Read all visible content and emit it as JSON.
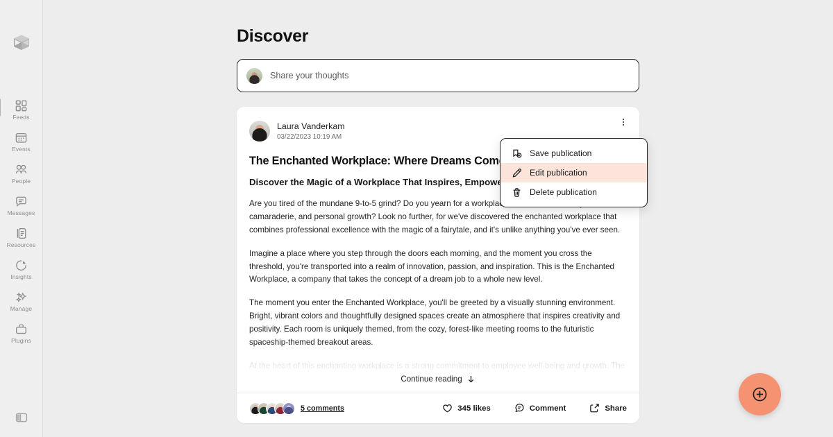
{
  "theme": {
    "app_bg": "#ededed",
    "sidebar_bg": "#f0efef",
    "card_bg": "#ffffff",
    "accent": "#f59272",
    "menu_highlight": "#fde4db",
    "text_primary": "#121212",
    "text_muted": "#6e6c6b"
  },
  "sidebar": {
    "logo_icon": "cube-logo-icon",
    "items": [
      {
        "label": "Feeds",
        "icon": "grid-squares-icon",
        "active": true
      },
      {
        "label": "Events",
        "icon": "calendar-icon",
        "active": false
      },
      {
        "label": "People",
        "icon": "people-icon",
        "active": false
      },
      {
        "label": "Messages",
        "icon": "chat-bubble-icon",
        "active": false
      },
      {
        "label": "Resources",
        "icon": "documents-icon",
        "active": false
      },
      {
        "label": "Insights",
        "icon": "pie-chart-icon",
        "active": false
      },
      {
        "label": "Manage",
        "icon": "sparkles-icon",
        "active": false
      },
      {
        "label": "Plugins",
        "icon": "toolbox-icon",
        "active": false
      }
    ],
    "bottom_icon": "panel-toggle-icon"
  },
  "header": {
    "title": "Discover"
  },
  "composer": {
    "placeholder": "Share your thoughts",
    "avatar_icon": "user-avatar"
  },
  "post": {
    "author": "Laura Vanderkam",
    "timestamp": "03/22/2023 10:19 AM",
    "avatar_icon": "user-avatar",
    "kebab_icon": "more-vertical-icon",
    "title": "The Enchanted Workplace: Where Dreams Come True",
    "subtitle": "Discover the Magic of a Workplace That Inspires, Empowers",
    "paragraphs": [
      "Are you tired of the mundane 9-to-5 grind? Do you yearn for a workplace that fosters creativity, camaraderie, and personal growth? Look no further, for we've discovered the enchanted workplace that combines professional excellence with the magic of a fairytale, and it's unlike anything you've ever seen.",
      "Imagine a place where you step through the doors each morning, and the moment you cross the threshold, you're transported into a realm of innovation, passion, and inspiration. This is the Enchanted Workplace, a company that takes the concept of a dream job to a whole new level.",
      "The moment you enter the Enchanted Workplace, you'll be greeted by a visually stunning environment. Bright, vibrant colors and thoughtfully designed spaces create an atmosphere that inspires creativity and positivity. Each room is uniquely themed, from the cozy, forest-like meeting rooms to the futuristic spaceship-themed breakout areas.",
      "At the heart of this enchanting workplace is a strong commitment to employee well-being and growth. The"
    ],
    "continue_reading": "Continue reading",
    "continue_icon": "arrow-down-icon",
    "footer": {
      "comments_label": "5 comments",
      "commenter_avatars": [
        "avatar-1",
        "avatar-2",
        "avatar-3",
        "avatar-4",
        "avatar-5"
      ],
      "likes_label": "345 likes",
      "like_icon": "heart-icon",
      "comment_label": "Comment",
      "comment_icon": "comment-icon",
      "share_label": "Share",
      "share_icon": "share-icon"
    }
  },
  "context_menu": {
    "items": [
      {
        "label": "Save publication",
        "icon": "bookmark-plus-icon",
        "highlighted": false
      },
      {
        "label": "Edit publication",
        "icon": "pencil-icon",
        "highlighted": true
      },
      {
        "label": "Delete publication",
        "icon": "trash-icon",
        "highlighted": false
      }
    ]
  },
  "fab": {
    "icon": "plus-circle-icon",
    "label": "Create"
  }
}
